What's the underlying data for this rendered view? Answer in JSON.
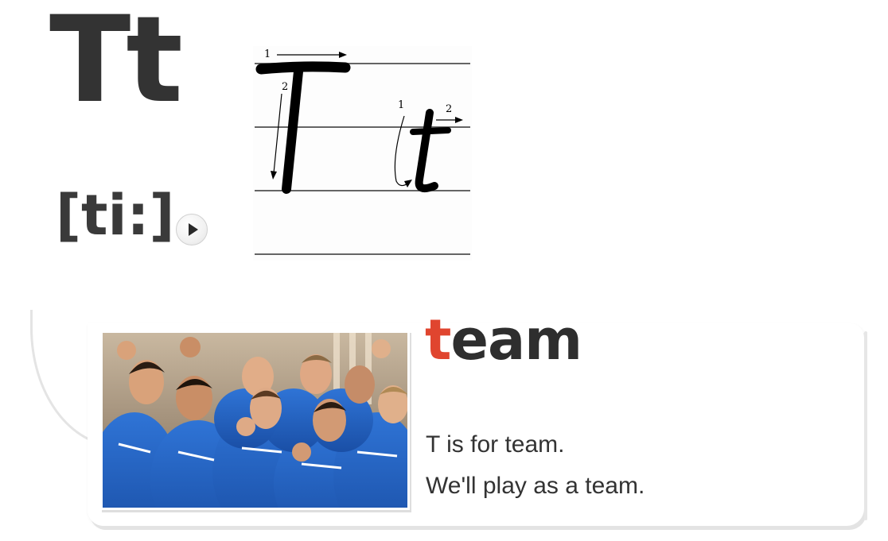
{
  "letter": {
    "display": "Tt",
    "phonetic": "[ti:]",
    "play_label": "play"
  },
  "writing_guide": {
    "uppercase": "T",
    "lowercase": "t",
    "uppercase_steps": [
      "1",
      "2"
    ],
    "lowercase_steps": [
      "1",
      "2"
    ]
  },
  "card": {
    "word_first_letter": "t",
    "word_rest": "eam",
    "sentences": [
      "T is for team.",
      "We'll play as a team."
    ]
  },
  "colors": {
    "highlight": "#e0452f",
    "text": "#333333",
    "jersey_blue": "#1f5fc2"
  },
  "icons": {
    "play": "play-icon"
  }
}
